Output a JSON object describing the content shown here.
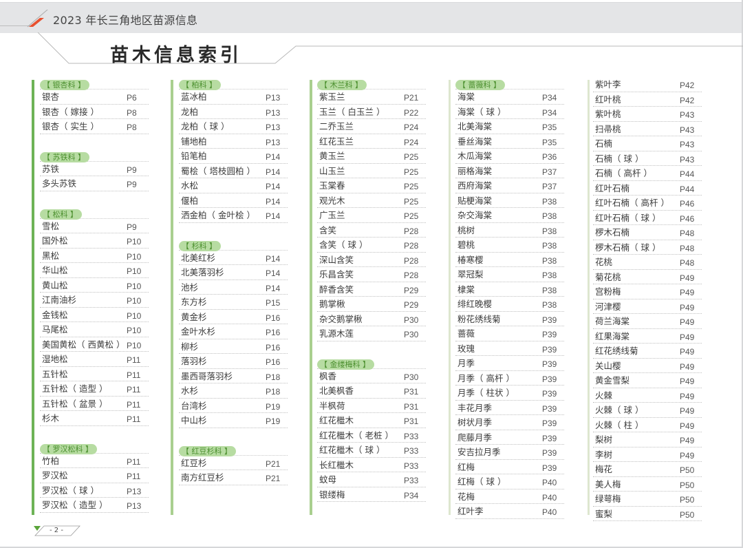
{
  "header": {
    "publication_title": "2023 年长三角地区苗源信息",
    "accent_color": "#e8502f"
  },
  "page_title": "苗木信息索引",
  "colors": {
    "family_label_bg": "#b7dca2",
    "family_label_text": "#4b8f2e",
    "column_bar": "#6db356"
  },
  "columns": [
    {
      "groups": [
        {
          "family": "【 银杏科 】",
          "entries": [
            {
              "name": "银杏",
              "page": "P6"
            },
            {
              "name": "银杏（ 嫁接 ）",
              "page": "P8"
            },
            {
              "name": "银杏（ 实生 ）",
              "page": "P8"
            }
          ]
        },
        {
          "family": "【 苏铁科 】",
          "entries": [
            {
              "name": "苏铁",
              "page": "P9"
            },
            {
              "name": "多头苏铁",
              "page": "P9"
            }
          ]
        },
        {
          "family": "【 松科 】",
          "entries": [
            {
              "name": "雪松",
              "page": "P9"
            },
            {
              "name": "国外松",
              "page": "P10"
            },
            {
              "name": "黑松",
              "page": "P10"
            },
            {
              "name": "华山松",
              "page": "P10"
            },
            {
              "name": "黄山松",
              "page": "P10"
            },
            {
              "name": "江南油杉",
              "page": "P10"
            },
            {
              "name": "金钱松",
              "page": "P10"
            },
            {
              "name": "马尾松",
              "page": "P10"
            },
            {
              "name": "美国黄松（ 西黄松 ）",
              "page": "P10"
            },
            {
              "name": "湿地松",
              "page": "P11"
            },
            {
              "name": "五针松",
              "page": "P11"
            },
            {
              "name": "五针松（ 造型 ）",
              "page": "P11"
            },
            {
              "name": "五针松（ 盆景 ）",
              "page": "P11"
            },
            {
              "name": "杉木",
              "page": "P11"
            }
          ]
        },
        {
          "family": "【 罗汉松科 】",
          "entries": [
            {
              "name": "竹柏",
              "page": "P11"
            },
            {
              "name": "罗汉松",
              "page": "P11"
            },
            {
              "name": "罗汉松（ 球 ）",
              "page": "P13"
            },
            {
              "name": "罗汉松（ 造型 ）",
              "page": "P13"
            }
          ]
        }
      ]
    },
    {
      "groups": [
        {
          "family": "【 柏科 】",
          "entries": [
            {
              "name": "蓝冰柏",
              "page": "P13"
            },
            {
              "name": "龙柏",
              "page": "P13"
            },
            {
              "name": "龙柏（ 球 ）",
              "page": "P13"
            },
            {
              "name": "铺地柏",
              "page": "P13"
            },
            {
              "name": "铅笔柏",
              "page": "P14"
            },
            {
              "name": "蜀桧（ 塔枝圆柏 ）",
              "page": "P14"
            },
            {
              "name": "水松",
              "page": "P14"
            },
            {
              "name": "偃柏",
              "page": "P14"
            },
            {
              "name": "洒金柏（ 金叶桧 ）",
              "page": "P14"
            }
          ]
        },
        {
          "family": "【 杉科 】",
          "entries": [
            {
              "name": "北美红杉",
              "page": "P14"
            },
            {
              "name": "北美落羽杉",
              "page": "P14"
            },
            {
              "name": "池杉",
              "page": "P14"
            },
            {
              "name": "东方杉",
              "page": "P15"
            },
            {
              "name": "黄金杉",
              "page": "P16"
            },
            {
              "name": "金叶水杉",
              "page": "P16"
            },
            {
              "name": "柳杉",
              "page": "P16"
            },
            {
              "name": "落羽杉",
              "page": "P16"
            },
            {
              "name": "墨西哥落羽杉",
              "page": "P18"
            },
            {
              "name": "水杉",
              "page": "P18"
            },
            {
              "name": "台湾杉",
              "page": "P19"
            },
            {
              "name": "中山杉",
              "page": "P19"
            }
          ]
        },
        {
          "family": "【 红豆杉科 】",
          "entries": [
            {
              "name": "红豆杉",
              "page": "P21"
            },
            {
              "name": "南方红豆杉",
              "page": "P21"
            }
          ]
        }
      ]
    },
    {
      "groups": [
        {
          "family": "【 木兰科 】",
          "entries": [
            {
              "name": "紫玉兰",
              "page": "P21"
            },
            {
              "name": "玉兰（ 白玉兰 ）",
              "page": "P22"
            },
            {
              "name": "二乔玉兰",
              "page": "P24"
            },
            {
              "name": "红花玉兰",
              "page": "P24"
            },
            {
              "name": "黄玉兰",
              "page": "P25"
            },
            {
              "name": "山玉兰",
              "page": "P25"
            },
            {
              "name": "玉棠春",
              "page": "P25"
            },
            {
              "name": "观光木",
              "page": "P25"
            },
            {
              "name": "广玉兰",
              "page": "P25"
            },
            {
              "name": "含笑",
              "page": "P28"
            },
            {
              "name": "含笑（ 球 ）",
              "page": "P28"
            },
            {
              "name": "深山含笑",
              "page": "P28"
            },
            {
              "name": "乐昌含笑",
              "page": "P28"
            },
            {
              "name": "醉香含笑",
              "page": "P29"
            },
            {
              "name": "鹅掌楸",
              "page": "P29"
            },
            {
              "name": "杂交鹅掌楸",
              "page": "P30"
            },
            {
              "name": "乳源木莲",
              "page": "P30"
            }
          ]
        },
        {
          "family": "【 金缕梅科 】",
          "entries": [
            {
              "name": "枫香",
              "page": "P30"
            },
            {
              "name": "北美枫香",
              "page": "P31"
            },
            {
              "name": "半枫荷",
              "page": "P31"
            },
            {
              "name": "红花檵木",
              "page": "P31"
            },
            {
              "name": "红花檵木（ 老桩 ）",
              "page": "P33"
            },
            {
              "name": "红花檵木（ 球 ）",
              "page": "P33"
            },
            {
              "name": "长红檵木",
              "page": "P33"
            },
            {
              "name": "蚊母",
              "page": "P33"
            },
            {
              "name": "银缕梅",
              "page": "P34"
            }
          ]
        }
      ]
    },
    {
      "groups": [
        {
          "family": "【 蔷薇科 】",
          "entries": [
            {
              "name": "海棠",
              "page": "P34"
            },
            {
              "name": "海棠（ 球 ）",
              "page": "P34"
            },
            {
              "name": "北美海棠",
              "page": "P35"
            },
            {
              "name": "垂丝海棠",
              "page": "P35"
            },
            {
              "name": "木瓜海棠",
              "page": "P36"
            },
            {
              "name": "丽格海棠",
              "page": "P37"
            },
            {
              "name": "西府海棠",
              "page": "P37"
            },
            {
              "name": "贴梗海棠",
              "page": "P38"
            },
            {
              "name": "杂交海棠",
              "page": "P38"
            },
            {
              "name": "桃树",
              "page": "P38"
            },
            {
              "name": "碧桃",
              "page": "P38"
            },
            {
              "name": "椿寒樱",
              "page": "P38"
            },
            {
              "name": "翠冠梨",
              "page": "P38"
            },
            {
              "name": "棣棠",
              "page": "P38"
            },
            {
              "name": "绯红晚樱",
              "page": "P38"
            },
            {
              "name": "粉花绣线菊",
              "page": "P39"
            },
            {
              "name": "蔷薇",
              "page": "P39"
            },
            {
              "name": "玫瑰",
              "page": "P39"
            },
            {
              "name": "月季",
              "page": "P39"
            },
            {
              "name": "月季（ 高杆 ）",
              "page": "P39"
            },
            {
              "name": "月季（ 柱状 ）",
              "page": "P39"
            },
            {
              "name": "丰花月季",
              "page": "P39"
            },
            {
              "name": "树状月季",
              "page": "P39"
            },
            {
              "name": "爬藤月季",
              "page": "P39"
            },
            {
              "name": "安吉拉月季",
              "page": "P39"
            },
            {
              "name": "红梅",
              "page": "P39"
            },
            {
              "name": "红梅（ 球 ）",
              "page": "P40"
            },
            {
              "name": "花梅",
              "page": "P40"
            },
            {
              "name": "红叶李",
              "page": "P40"
            }
          ]
        }
      ]
    },
    {
      "groups": [
        {
          "family": "",
          "entries": [
            {
              "name": "紫叶李",
              "page": "P42"
            },
            {
              "name": "红叶桃",
              "page": "P42"
            },
            {
              "name": "紫叶桃",
              "page": "P43"
            },
            {
              "name": "扫帚桃",
              "page": "P43"
            },
            {
              "name": "石楠",
              "page": "P43"
            },
            {
              "name": "石楠（ 球 ）",
              "page": "P43"
            },
            {
              "name": "石楠（ 高杆 ）",
              "page": "P44"
            },
            {
              "name": "红叶石楠",
              "page": "P44"
            },
            {
              "name": "红叶石楠（ 高杆 ）",
              "page": "P46"
            },
            {
              "name": "红叶石楠（ 球 ）",
              "page": "P46"
            },
            {
              "name": "椤木石楠",
              "page": "P48"
            },
            {
              "name": "椤木石楠（ 球 ）",
              "page": "P48"
            },
            {
              "name": "花桃",
              "page": "P48"
            },
            {
              "name": "菊花桃",
              "page": "P49"
            },
            {
              "name": "宫粉梅",
              "page": "P49"
            },
            {
              "name": "河津樱",
              "page": "P49"
            },
            {
              "name": "荷兰海棠",
              "page": "P49"
            },
            {
              "name": "红果海棠",
              "page": "P49"
            },
            {
              "name": "红花绣线菊",
              "page": "P49"
            },
            {
              "name": "关山樱",
              "page": "P49"
            },
            {
              "name": "黄金雪梨",
              "page": "P49"
            },
            {
              "name": "火棘",
              "page": "P49"
            },
            {
              "name": "火棘（ 球 ）",
              "page": "P49"
            },
            {
              "name": "火棘（ 柱 ）",
              "page": "P49"
            },
            {
              "name": "梨树",
              "page": "P49"
            },
            {
              "name": "李树",
              "page": "P49"
            },
            {
              "name": "梅花",
              "page": "P50"
            },
            {
              "name": "美人梅",
              "page": "P50"
            },
            {
              "name": "绿萼梅",
              "page": "P50"
            },
            {
              "name": "蜜梨",
              "page": "P50"
            }
          ]
        }
      ]
    }
  ],
  "footer": {
    "page_number": "- 2 -"
  }
}
